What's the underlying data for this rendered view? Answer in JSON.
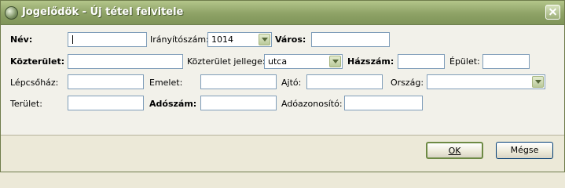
{
  "window": {
    "title": "Jogelődök - Új tétel felvitele"
  },
  "form": {
    "nev_label": "Név:",
    "nev_value": "",
    "iranyitoszam_label": "Irányítószám:",
    "iranyitoszam_value": "1014",
    "varos_label": "Város:",
    "varos_value": "",
    "kozterulet_label": "Közterület:",
    "kozterulet_value": "",
    "kozterulet_jellege_label": "Közterület jellege:",
    "kozterulet_jellege_value": "utca",
    "hazszam_label": "Házszám:",
    "hazszam_value": "",
    "epulet_label": "Épület:",
    "epulet_value": "",
    "lepcsohaz_label": "Lépcsőház:",
    "lepcsohaz_value": "",
    "emelet_label": "Emelet:",
    "emelet_value": "",
    "ajto_label": "Ajtó:",
    "ajto_value": "",
    "orszag_label": "Ország:",
    "orszag_value": "",
    "terulet_label": "Terület:",
    "terulet_value": "",
    "adoszam_label": "Adószám:",
    "adoszam_value": "",
    "adoazonosito_label": "Adóazonosító:",
    "adoazonosito_value": ""
  },
  "buttons": {
    "ok_label": "OK",
    "megse_label": "Mégse"
  },
  "colors": {
    "titlebar": "#8ea266",
    "input_border": "#7f9db9",
    "window_bg": "#ece9d8"
  }
}
